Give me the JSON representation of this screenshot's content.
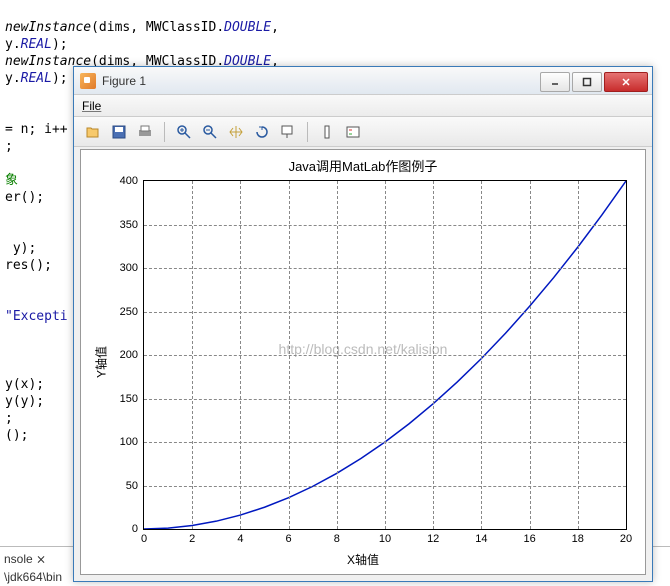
{
  "code": {
    "line1a": "newInstance",
    "line1b": "(dims, MWClassID.",
    "line1c": "DOUBLE",
    "line1d": ",",
    "line2a": "y.",
    "line2b": "REAL",
    "line2c": ");",
    "line3a": "newInstance",
    "line3b": "(dims, MWClassID.",
    "line3c": "DOUBLE",
    "line3d": ",",
    "line4a": "y.",
    "line4b": "REAL",
    "line4c": ");",
    "line6": "= n; i++",
    "line7": ";",
    "line8a": "象",
    "line8b": "er();",
    "line10": " y);",
    "line11": "res();",
    "line13": "\"Excepti",
    "line15": "y(x);",
    "line16": "y(y);",
    "line17": ";",
    "line18": "();"
  },
  "bottom_tab": "nsole ⨯",
  "bottom_path": "\\jdk664\\bin",
  "figure": {
    "title": "Figure 1",
    "menu_file": "File",
    "watermark": "http://blog.csdn.net/kalision"
  },
  "chart_data": {
    "type": "line",
    "title": "Java调用MatLab作图例子",
    "xlabel": "X轴值",
    "ylabel": "Y轴值",
    "xlim": [
      0,
      20
    ],
    "ylim": [
      0,
      400
    ],
    "x_ticks": [
      0,
      2,
      4,
      6,
      8,
      10,
      12,
      14,
      16,
      18,
      20
    ],
    "y_ticks": [
      0,
      50,
      100,
      150,
      200,
      250,
      300,
      350,
      400
    ],
    "x": [
      0,
      1,
      2,
      3,
      4,
      5,
      6,
      7,
      8,
      9,
      10,
      11,
      12,
      13,
      14,
      15,
      16,
      17,
      18,
      19,
      20
    ],
    "y": [
      0,
      1,
      4,
      9,
      16,
      25,
      36,
      49,
      64,
      81,
      100,
      121,
      144,
      169,
      196,
      225,
      256,
      289,
      324,
      361,
      400
    ]
  }
}
